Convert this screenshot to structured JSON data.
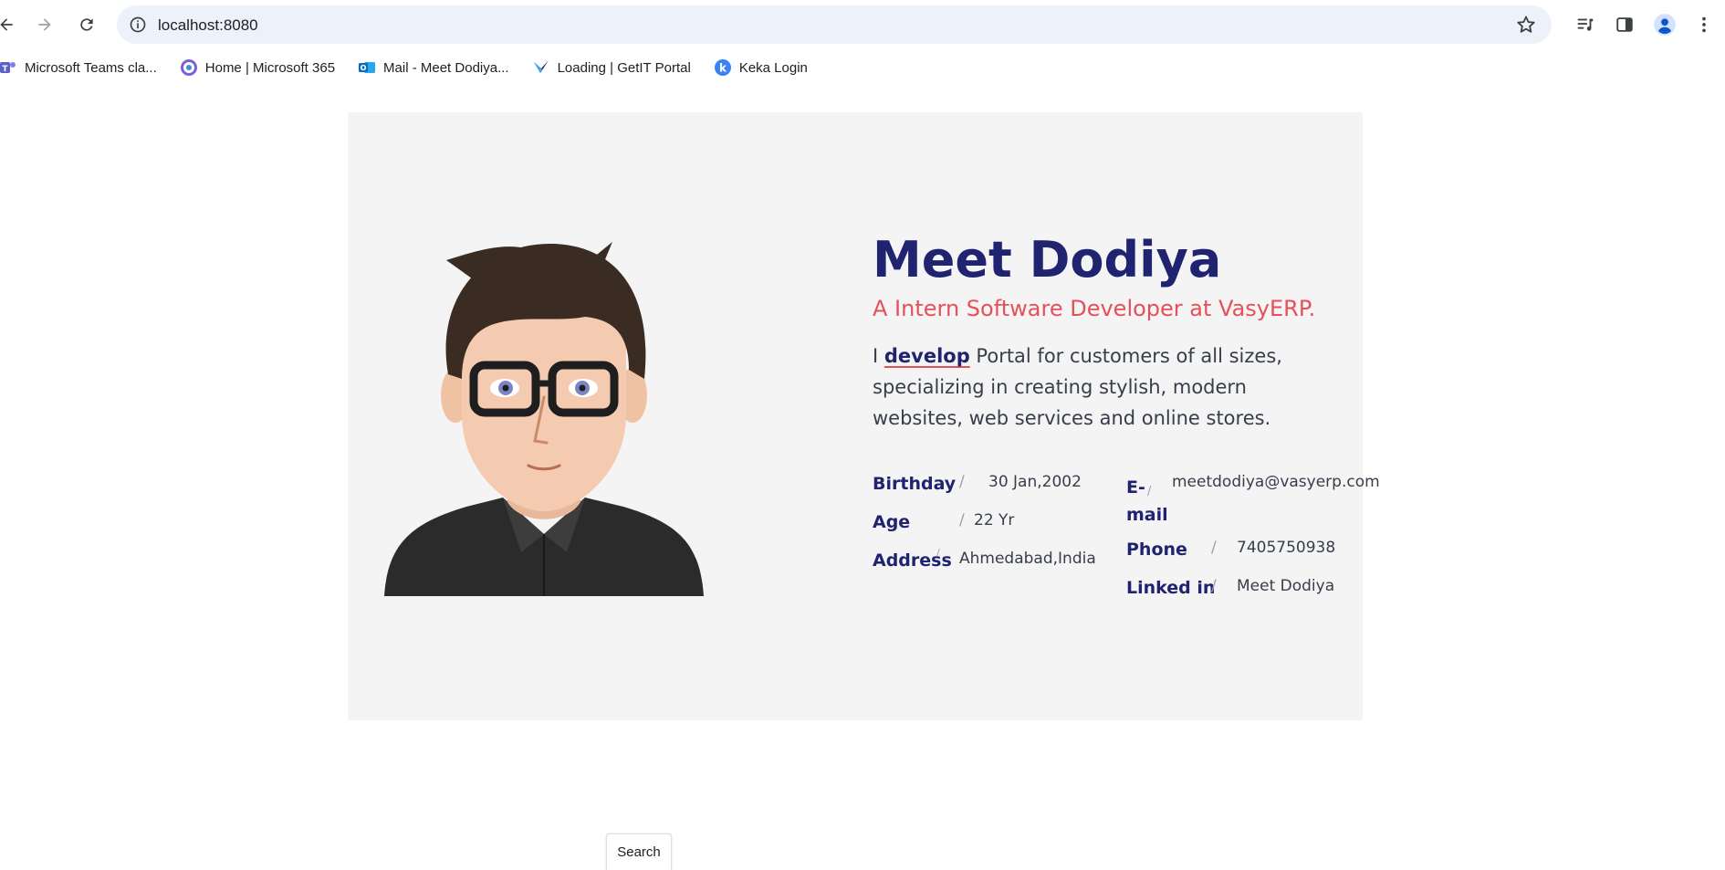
{
  "browser": {
    "url": "localhost:8080",
    "bookmarks": [
      {
        "label": "Microsoft Teams cla...",
        "icon": "teams-icon",
        "color": "#5b5fc7"
      },
      {
        "label": "Home | Microsoft 365",
        "icon": "microsoft365-icon",
        "color": "#7b61d9"
      },
      {
        "label": "Mail - Meet Dodiya...",
        "icon": "outlook-icon",
        "color": "#0f6cbd"
      },
      {
        "label": "Loading | GetIT Portal",
        "icon": "getit-icon",
        "color": "#1d2f6b"
      },
      {
        "label": "Keka Login",
        "icon": "keka-icon",
        "color": "#3b82f6"
      }
    ]
  },
  "profile": {
    "name": "Meet Dodiya",
    "role": "A Intern Software Developer at VasyERP.",
    "desc_prefix": "I ",
    "desc_keyword": "develop",
    "desc_rest": " Portal for customers of all sizes, specializing in creating stylish, modern websites, web services and online stores.",
    "details_left": [
      {
        "label": "Birthday",
        "sep": "/",
        "value": "30 Jan,2002"
      },
      {
        "label": "Age",
        "sep": "/",
        "value": "22 Yr"
      },
      {
        "label": "Address",
        "sep": "/",
        "value": "Ahmedabad,India"
      }
    ],
    "details_right": [
      {
        "label": "E-\nmail",
        "sep": "/",
        "value": "meetdodiya@vasyerp.com"
      },
      {
        "label": "Phone",
        "sep": "/",
        "value": "7405750938"
      },
      {
        "label": "Linked in",
        "sep": "/",
        "value": "Meet Dodiya"
      }
    ]
  },
  "search_button_label": "Search",
  "colors": {
    "name": "#1f2370",
    "role": "#e5505a",
    "card_bg": "#f4f4f4"
  }
}
